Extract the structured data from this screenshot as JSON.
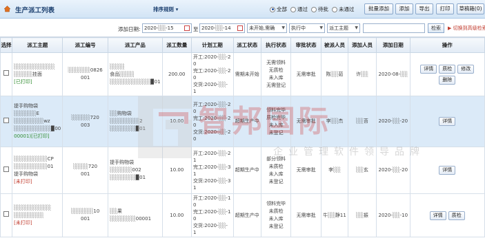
{
  "header": {
    "title": "生产派工列表",
    "sort_label": "排序规则",
    "status_filters": [
      {
        "label": "全部",
        "checked": true
      },
      {
        "label": "通过",
        "checked": false
      },
      {
        "label": "待批",
        "checked": false
      },
      {
        "label": "未通过",
        "checked": false
      }
    ],
    "buttons": [
      "批量添加",
      "添加",
      "导出",
      "打印",
      "草稿箱(0)"
    ]
  },
  "filters": {
    "date_label": "添加日期:",
    "date_from": "2020-░░-15",
    "date_to_label": "至",
    "date_to": "2020-░░-14",
    "status_select": "未开始,需确",
    "exec_select": "执行中",
    "subject_select": "派工主题",
    "search_button": "检索",
    "switch_link": "切换到高级检索"
  },
  "table": {
    "columns": [
      "选择",
      "派工主题",
      "派工编号",
      "派工产品",
      "派工数量",
      "计划工期",
      "派工状态",
      "执行状态",
      "审批状态",
      "被派人员",
      "添加人员",
      "添加日期",
      "操作"
    ],
    "rows": [
      {
        "subject_lines": [
          "░░░░░░░░░░░",
          "░░░░░挂面"
        ],
        "print_tag": "[已打印]",
        "print_tag_color": "green",
        "code_lines": [
          "░░░░░░0826",
          "001"
        ],
        "product_lines": [
          "░░░░",
          "食品░░░░",
          "░░░░░░░░░░░▉01"
        ],
        "quantity": "200.00",
        "schedule_lines": [
          "开工:2020-░░-2",
          "0",
          "完工:2020-░░-2",
          "0",
          "交货:2020-░░-",
          "1"
        ],
        "dispatch_status": "需期未开始",
        "exec_lines": [
          "无需领料",
          "无质检",
          "未入库",
          "无需登记"
        ],
        "approval": "无需审批",
        "assignee": "陈░░茹",
        "adder": "许░░",
        "date": "2020-08-░░",
        "ops": [
          "详情",
          "质检",
          "修改",
          "删除"
        ],
        "selected": false
      },
      {
        "subject_lines": [
          "提手购物袋",
          "░░░░░░E",
          "░░░░░░░░wz",
          "░░░░░░░░░░▉00"
        ],
        "print_tag": "00001)[已打印]",
        "print_tag_color": "green",
        "code_lines": [
          "░░░░░720",
          "003"
        ],
        "product_lines": [
          "░░购物袋",
          "░░░░░░░░2",
          "░░░░░░░▉01"
        ],
        "quantity": "10.00",
        "schedule_lines": [
          "开工:2020-░░-2",
          "0",
          "完工:2020-░░-2",
          "0",
          "交货:2020-░░-2",
          "0"
        ],
        "dispatch_status": "超期生产中",
        "exec_lines": [
          "领料完毕",
          "质检完毕",
          "未入库",
          "未登记"
        ],
        "approval": "无需审批",
        "assignee": "李░░杰",
        "adder": "░░苔",
        "date": "2020-░░-20",
        "ops": [
          "详情"
        ],
        "selected": true
      },
      {
        "subject_lines": [
          "░░░░░░░░░CP",
          "░░░░░░░░░01",
          "提手购物袋"
        ],
        "print_tag": "[未打印]",
        "print_tag_color": "red",
        "code_lines": [
          "░░░░720",
          "001"
        ],
        "product_lines": [
          "提手购物袋",
          "░░░░░░002",
          "░░░░░░░▉01"
        ],
        "quantity": "10.00",
        "schedule_lines": [
          "开工:2020-░░-2",
          "1",
          "完工:2020-░░-3",
          "1",
          "交货:2020-░░-3",
          "1"
        ],
        "dispatch_status": "超期生产中",
        "exec_lines": [
          "部分领料",
          "未质检",
          "未入库",
          "未登记"
        ],
        "approval": "无需审批",
        "assignee": "李░░",
        "adder": "░░玄",
        "date": "2020-░░-20",
        "ops": [
          "详情"
        ],
        "selected": false
      },
      {
        "subject_lines": [
          "░░░░░░░░░░",
          "░░░░░░░░"
        ],
        "print_tag": "[未打印]",
        "print_tag_color": "red",
        "code_lines": [
          "░░░░░░10",
          "001"
        ],
        "product_lines": [
          "░░果",
          "░░░░░░░00001"
        ],
        "quantity": "10.00",
        "schedule_lines": [
          "开工:2020-░░-1",
          "0",
          "完工:2020-░░-1",
          "0",
          "交货:2020-░░-",
          "1"
        ],
        "dispatch_status": "超期生产中",
        "exec_lines": [
          "领料完毕",
          "未质检",
          "未入库",
          "未登记"
        ],
        "approval": "无需审批",
        "assignee": "牛░░静11",
        "adder": "░░振",
        "date": "2020-░░-10",
        "ops": [
          "详情",
          "质检"
        ],
        "selected": false
      }
    ]
  },
  "watermark": {
    "brand": "智邦国际",
    "slogan": "企业管理软件领导品牌"
  },
  "colors": {
    "header_bg": "#d2e4f5",
    "selected_row": "#dbeaf8",
    "printed_tag": "#2e8b2e",
    "unprinted_tag": "#c0392b",
    "watermark_red": "#d14a4a"
  }
}
